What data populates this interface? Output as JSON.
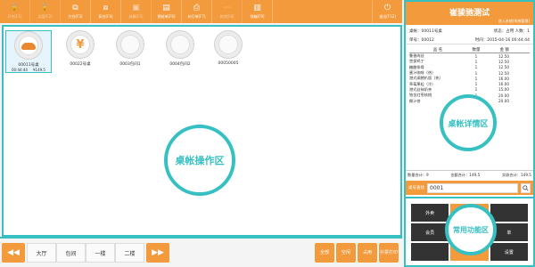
{
  "toolbar": {
    "buttons": [
      {
        "icon": "lock-icon",
        "label": "开台[F1]",
        "dim": true
      },
      {
        "icon": "lock2-icon",
        "label": "点菜[F2]",
        "dim": true
      },
      {
        "icon": "merge-icon",
        "label": "并台[F3]",
        "dim": false
      },
      {
        "icon": "split-icon",
        "label": "拆台[F4]",
        "dim": false
      },
      {
        "icon": "settle-icon",
        "label": "结算[F5]",
        "dim": true
      },
      {
        "icon": "pay-icon",
        "label": "预结单[F6]",
        "dim": false
      },
      {
        "icon": "print-icon",
        "label": "补打单[F7]",
        "dim": false
      },
      {
        "icon": "more-icon",
        "label": "其他[F8]",
        "dim": true
      },
      {
        "icon": "cash-icon",
        "label": "钱箱[F9]",
        "dim": false
      }
    ],
    "exit": {
      "icon": "exit-icon",
      "label": "退出[F12]"
    }
  },
  "tables": [
    {
      "name": "00011号桌",
      "time": "00:44:44",
      "amount": "¥149.5",
      "type": "food",
      "busy": true
    },
    {
      "name": "00022号桌",
      "time": "",
      "amount": "",
      "type": "yen",
      "busy": false
    },
    {
      "name": "0003包间1",
      "time": "",
      "amount": "",
      "type": "empty",
      "busy": false
    },
    {
      "name": "0004包间2",
      "time": "",
      "amount": "",
      "type": "empty",
      "busy": false
    },
    {
      "name": "00050005",
      "time": "",
      "amount": "",
      "type": "empty",
      "busy": false
    }
  ],
  "overlay": {
    "ops": "桌帐操作区",
    "detail": "桌帐详情区",
    "func": "常用功能区"
  },
  "bottombar": {
    "prev": "◀◀",
    "next": "▶▶",
    "areas": [
      "大厅",
      "包间",
      "一楼",
      "二楼"
    ],
    "status": [
      "全部",
      "空闲",
      "占用",
      "补票打印"
    ]
  },
  "right": {
    "title": "崔骏驰测试",
    "subtitle": "进入系统[系统管理]",
    "table_label": "桌帐：00011号桌",
    "status_label": "状态：占用 人数：1",
    "bill_no": "单号：00012",
    "time": "时间：2015-04-16 00:44:44",
    "headers": {
      "name": "品  名",
      "qty": "数量",
      "amount": "金  额"
    },
    "items": [
      {
        "name": "鲁香肉丝",
        "qty": "1",
        "amount": "12.50"
      },
      {
        "name": "宫保鸡丁",
        "qty": "1",
        "amount": "12.50"
      },
      {
        "name": "糖醋排骨",
        "qty": "1",
        "amount": "12.50"
      },
      {
        "name": "蜜汁咖啡（热）",
        "qty": "1",
        "amount": "12.50"
      },
      {
        "name": "港式焗猪扒饭（热）",
        "qty": "1",
        "amount": "16.00"
      },
      {
        "name": "草莓果粒（冷）",
        "qty": "1",
        "amount": "16.00"
      },
      {
        "name": "港式丝袜奶茶",
        "qty": "1",
        "amount": "15.00"
      },
      {
        "name": "铂金红枣核桃",
        "qty": "1",
        "amount": "20.00"
      },
      {
        "name": "椰汁饼",
        "qty": "1",
        "amount": "20.00"
      }
    ],
    "totals": {
      "count": "数量合计：9",
      "amount": "金额合计：149.5",
      "paid": "实收合计：149.5"
    },
    "search": {
      "label": "桌号查找",
      "value": "0001",
      "icon": "search-icon"
    },
    "func_buttons": [
      "外卖",
      "",
      "",
      "会员",
      "",
      "单",
      "",
      "",
      "设置"
    ]
  }
}
